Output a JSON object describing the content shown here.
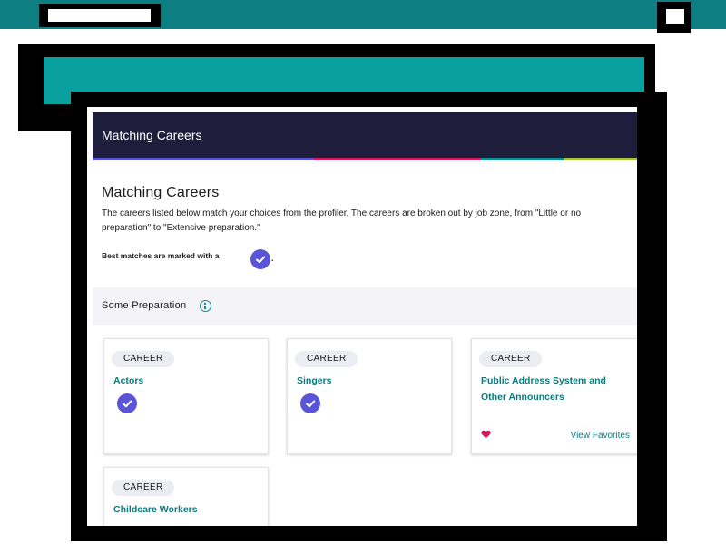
{
  "screen": {
    "header_title": "Matching Careers",
    "heading": "Matching Careers",
    "intro_line1": "The careers listed below match your choices from the profiler. The careers are broken out by job zone, from \"Little or no",
    "intro_line2": "preparation\" to \"Extensive preparation.\"",
    "best_matches_text": "Best matches are marked with a",
    "best_matches_period": ".",
    "section_label": "Some Preparation"
  },
  "cards": [
    {
      "badge": "CAREER",
      "title": "Actors",
      "best_match": true
    },
    {
      "badge": "CAREER",
      "title": "Singers",
      "best_match": true
    },
    {
      "badge": "CAREER",
      "title_line1": "Public Address System and",
      "title_line2": "Other Announcers",
      "favorite_link": "View Favorites",
      "best_match": false
    },
    {
      "badge": "CAREER",
      "title": "Childcare Workers",
      "best_match": false
    }
  ],
  "colors": {
    "topbar": "#0d7e82",
    "header": "#1e1d3c",
    "accent_purple": "#5a55d6",
    "accent_pink": "#d6195f",
    "link_teal": "#0b7a7d"
  },
  "icons": [
    "check-icon",
    "info-icon",
    "heart-icon"
  ]
}
